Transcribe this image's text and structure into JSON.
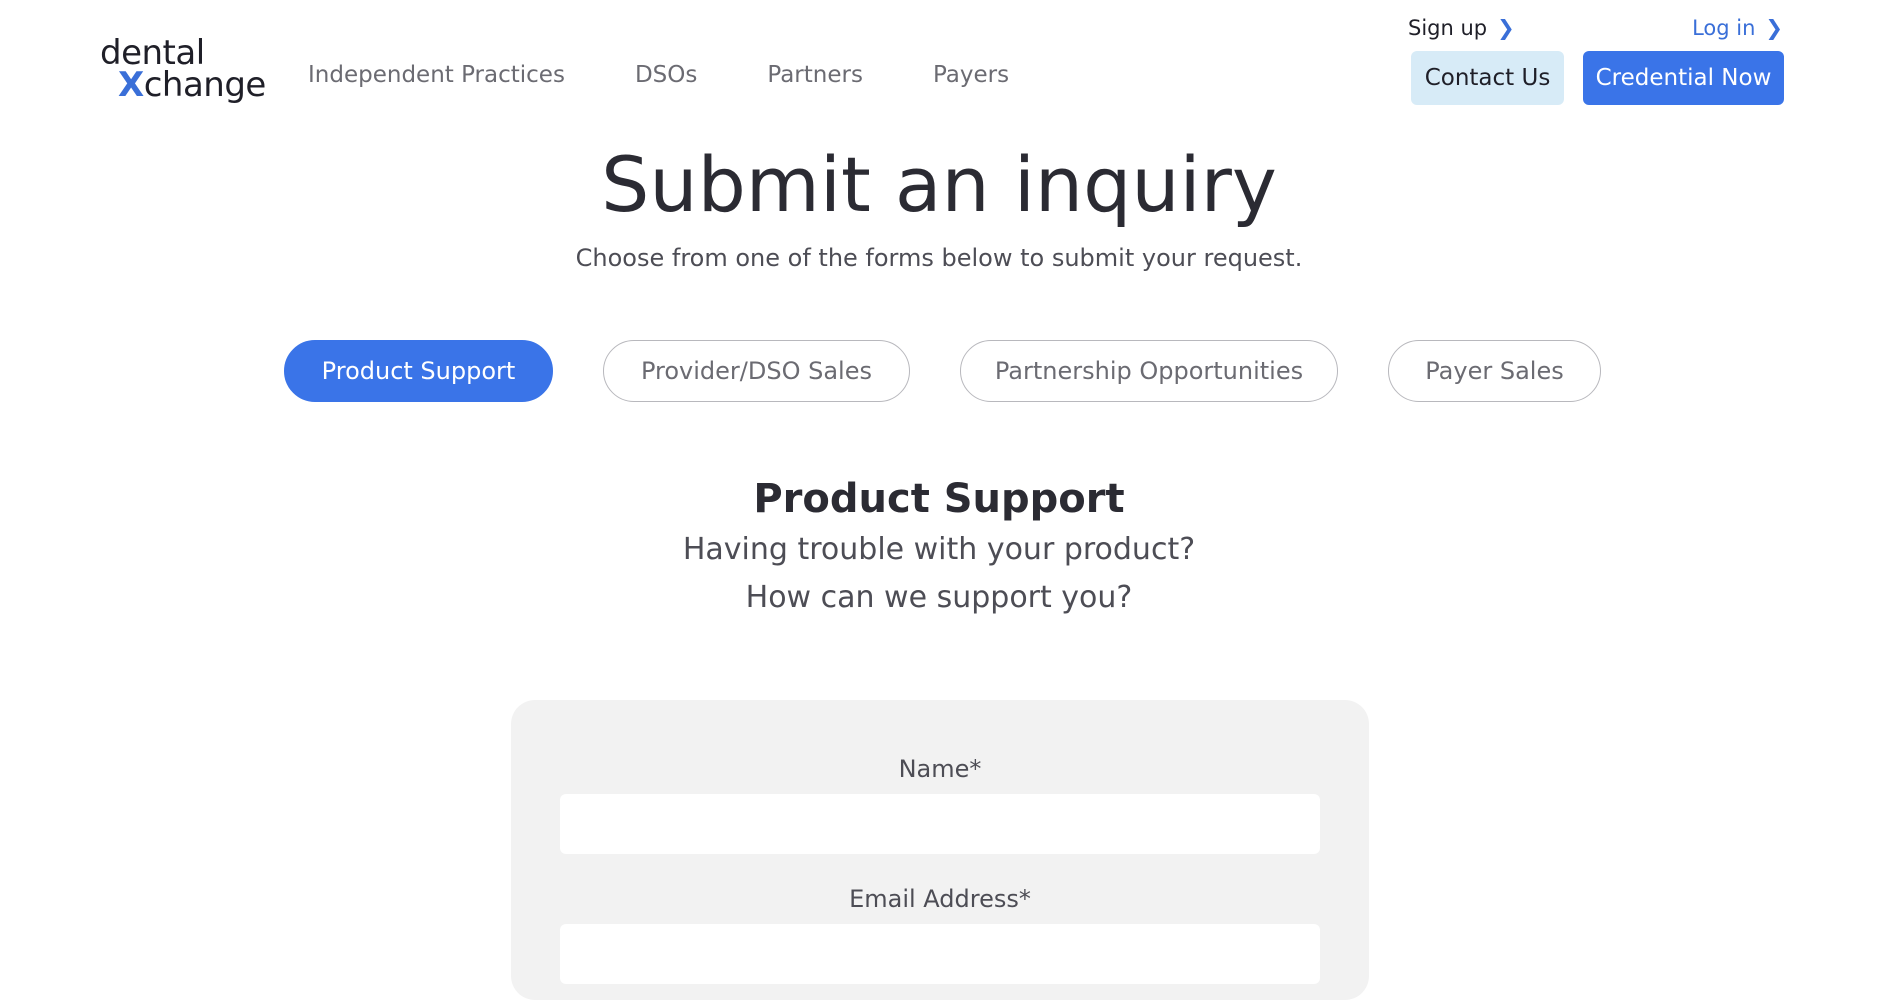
{
  "header": {
    "logo": {
      "line1": "dental",
      "line2_accent": "X",
      "line2_rest": "change"
    },
    "nav": [
      "Independent Practices",
      "DSOs",
      "Partners",
      "Payers"
    ],
    "signup_label": "Sign up",
    "login_label": "Log in",
    "chevron": "❯",
    "contact_label": "Contact Us",
    "credential_label": "Credential Now"
  },
  "hero": {
    "title": "Submit an inquiry",
    "subtitle": "Choose from one of the forms below to submit your request."
  },
  "tabs": [
    {
      "label": "Product Support",
      "active": true
    },
    {
      "label": "Provider/DSO Sales",
      "active": false
    },
    {
      "label": "Partnership Opportunities",
      "active": false
    },
    {
      "label": "Payer Sales",
      "active": false
    }
  ],
  "section": {
    "title": "Product Support",
    "line1": "Having trouble with your product?",
    "line2": "How can we support you?"
  },
  "form": {
    "name_label": "Name*",
    "name_value": "",
    "email_label": "Email Address*",
    "email_value": ""
  },
  "colors": {
    "accent": "#3a74e8",
    "contact_bg": "#d7ebf7",
    "card_bg": "#f2f2f2"
  }
}
